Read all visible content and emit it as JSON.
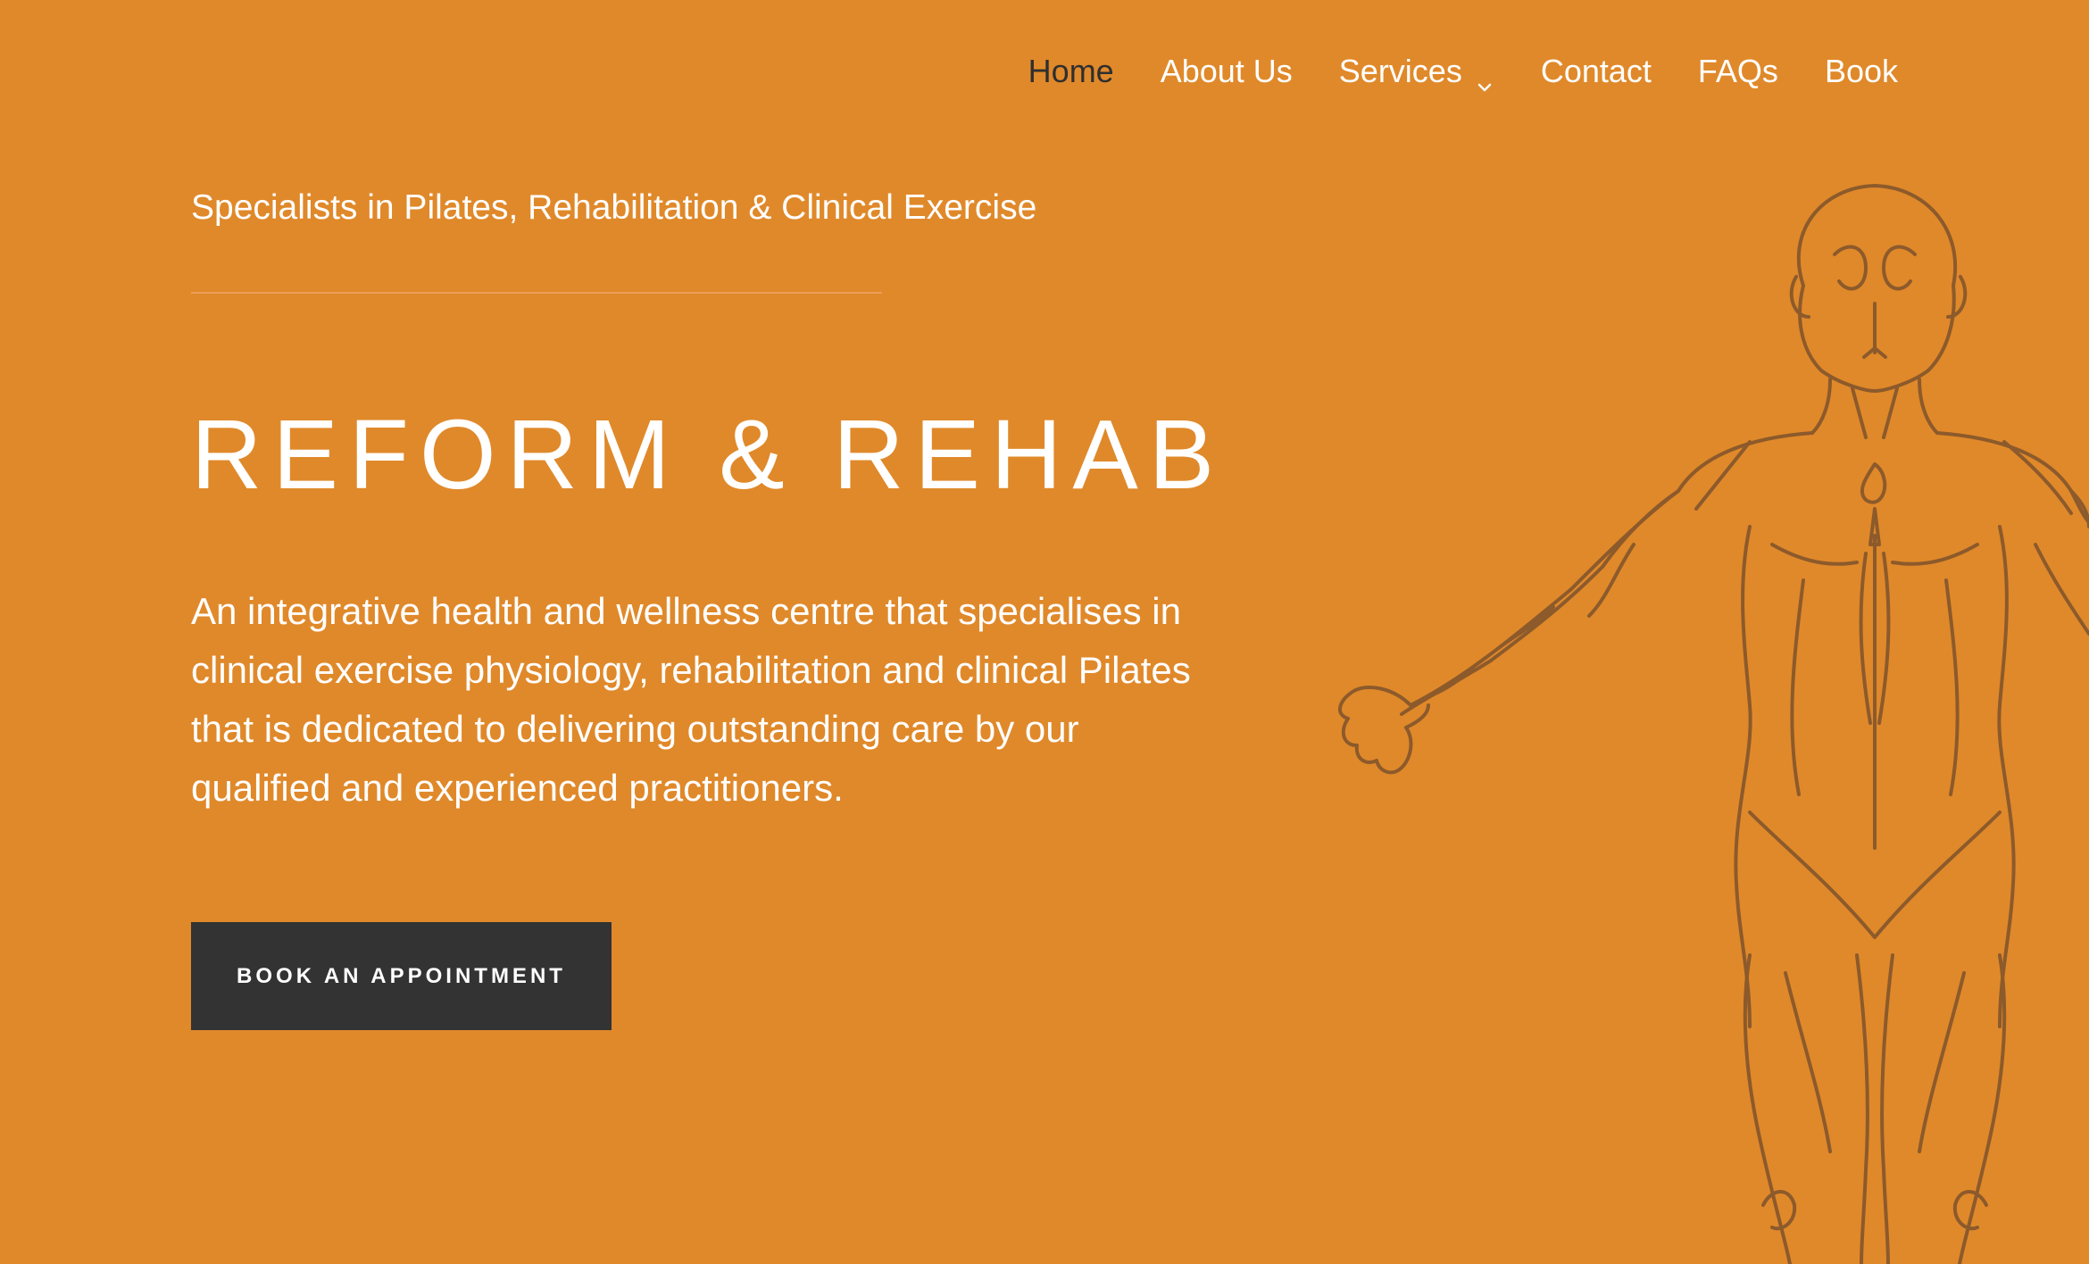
{
  "nav": {
    "items": [
      {
        "label": "Home",
        "active": true
      },
      {
        "label": "About Us"
      },
      {
        "label": "Services",
        "has_dropdown": true,
        "dropdown_icon": "chevron-down-icon"
      },
      {
        "label": "Contact"
      },
      {
        "label": "FAQs"
      },
      {
        "label": "Book"
      }
    ]
  },
  "hero": {
    "subtitle": "Specialists in Pilates, Rehabilitation & Clinical Exercise",
    "title": "REFORM & REHAB",
    "description": "An integrative health and wellness centre that specialises in clinical exercise physiology, rehabilitation and clinical Pilates that is dedicated to delivering outstanding care by our qualified and experienced practitioners.",
    "cta_label": "Book an appointment",
    "illustration": "anatomy-figure-illustration"
  },
  "colors": {
    "background": "#e0892a",
    "text": "#ffffff",
    "active_nav": "#2f2f2f",
    "button": "#333333",
    "line_art": "#8c5a2b"
  }
}
